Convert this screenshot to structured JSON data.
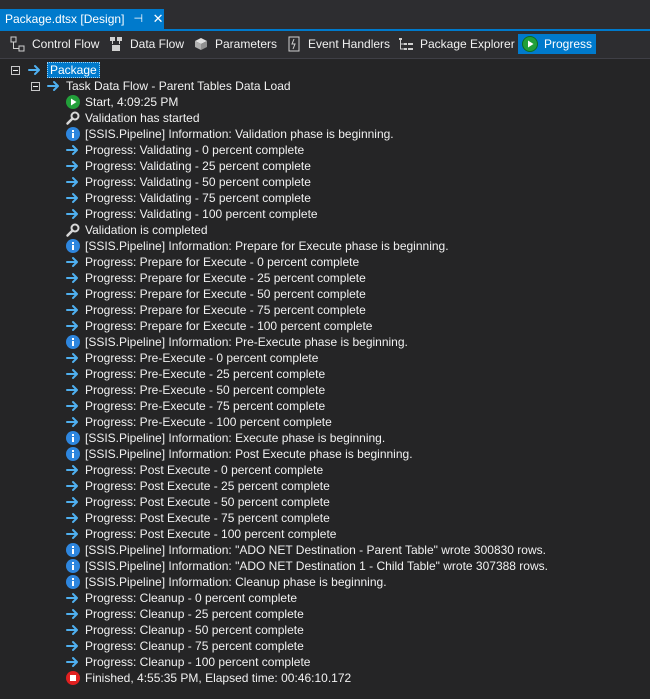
{
  "document_tab": {
    "title": "Package.dtsx [Design]",
    "pin_glyph": "⊣",
    "close_glyph": "✕"
  },
  "toolbar": {
    "control_flow": "Control Flow",
    "data_flow": "Data Flow",
    "parameters": "Parameters",
    "event_handlers": "Event Handlers",
    "package_explorer": "Package Explorer",
    "progress": "Progress"
  },
  "colors": {
    "accent": "#007acc",
    "background": "#252526",
    "arrow": "#4fb0f0",
    "info": "#2e86de",
    "start": "#22a03a",
    "stop": "#e02020"
  },
  "tree": {
    "root": {
      "label": "Package",
      "icon": "arrow-icon"
    },
    "task": {
      "label": "Task Data Flow - Parent Tables Data Load",
      "icon": "arrow-icon"
    },
    "entries": [
      {
        "icon": "start-icon",
        "text": "Start, 4:09:25 PM"
      },
      {
        "icon": "magnifier-icon",
        "text": "Validation has started"
      },
      {
        "icon": "info-icon",
        "text": "[SSIS.Pipeline] Information: Validation phase is beginning."
      },
      {
        "icon": "arrow-icon",
        "text": "Progress: Validating - 0 percent complete"
      },
      {
        "icon": "arrow-icon",
        "text": "Progress: Validating - 25 percent complete"
      },
      {
        "icon": "arrow-icon",
        "text": "Progress: Validating - 50 percent complete"
      },
      {
        "icon": "arrow-icon",
        "text": "Progress: Validating - 75 percent complete"
      },
      {
        "icon": "arrow-icon",
        "text": "Progress: Validating - 100 percent complete"
      },
      {
        "icon": "magnifier-icon",
        "text": "Validation is completed"
      },
      {
        "icon": "info-icon",
        "text": "[SSIS.Pipeline] Information: Prepare for Execute phase is beginning."
      },
      {
        "icon": "arrow-icon",
        "text": "Progress: Prepare for Execute - 0 percent complete"
      },
      {
        "icon": "arrow-icon",
        "text": "Progress: Prepare for Execute - 25 percent complete"
      },
      {
        "icon": "arrow-icon",
        "text": "Progress: Prepare for Execute - 50 percent complete"
      },
      {
        "icon": "arrow-icon",
        "text": "Progress: Prepare for Execute - 75 percent complete"
      },
      {
        "icon": "arrow-icon",
        "text": "Progress: Prepare for Execute - 100 percent complete"
      },
      {
        "icon": "info-icon",
        "text": "[SSIS.Pipeline] Information: Pre-Execute phase is beginning."
      },
      {
        "icon": "arrow-icon",
        "text": "Progress: Pre-Execute - 0 percent complete"
      },
      {
        "icon": "arrow-icon",
        "text": "Progress: Pre-Execute - 25 percent complete"
      },
      {
        "icon": "arrow-icon",
        "text": "Progress: Pre-Execute - 50 percent complete"
      },
      {
        "icon": "arrow-icon",
        "text": "Progress: Pre-Execute - 75 percent complete"
      },
      {
        "icon": "arrow-icon",
        "text": "Progress: Pre-Execute - 100 percent complete"
      },
      {
        "icon": "info-icon",
        "text": "[SSIS.Pipeline] Information: Execute phase is beginning."
      },
      {
        "icon": "info-icon",
        "text": "[SSIS.Pipeline] Information: Post Execute phase is beginning."
      },
      {
        "icon": "arrow-icon",
        "text": "Progress: Post Execute - 0 percent complete"
      },
      {
        "icon": "arrow-icon",
        "text": "Progress: Post Execute - 25 percent complete"
      },
      {
        "icon": "arrow-icon",
        "text": "Progress: Post Execute - 50 percent complete"
      },
      {
        "icon": "arrow-icon",
        "text": "Progress: Post Execute - 75 percent complete"
      },
      {
        "icon": "arrow-icon",
        "text": "Progress: Post Execute - 100 percent complete"
      },
      {
        "icon": "info-icon",
        "text": "[SSIS.Pipeline] Information: \"ADO NET Destination - Parent Table\" wrote 300830 rows."
      },
      {
        "icon": "info-icon",
        "text": "[SSIS.Pipeline] Information: \"ADO NET Destination 1 - Child Table\" wrote 307388 rows."
      },
      {
        "icon": "info-icon",
        "text": "[SSIS.Pipeline] Information: Cleanup phase is beginning."
      },
      {
        "icon": "arrow-icon",
        "text": "Progress: Cleanup - 0 percent complete"
      },
      {
        "icon": "arrow-icon",
        "text": "Progress: Cleanup - 25 percent complete"
      },
      {
        "icon": "arrow-icon",
        "text": "Progress: Cleanup - 50 percent complete"
      },
      {
        "icon": "arrow-icon",
        "text": "Progress: Cleanup - 75 percent complete"
      },
      {
        "icon": "arrow-icon",
        "text": "Progress: Cleanup - 100 percent complete"
      },
      {
        "icon": "stop-icon",
        "text": "Finished, 4:55:35 PM, Elapsed time: 00:46:10.172"
      }
    ]
  }
}
